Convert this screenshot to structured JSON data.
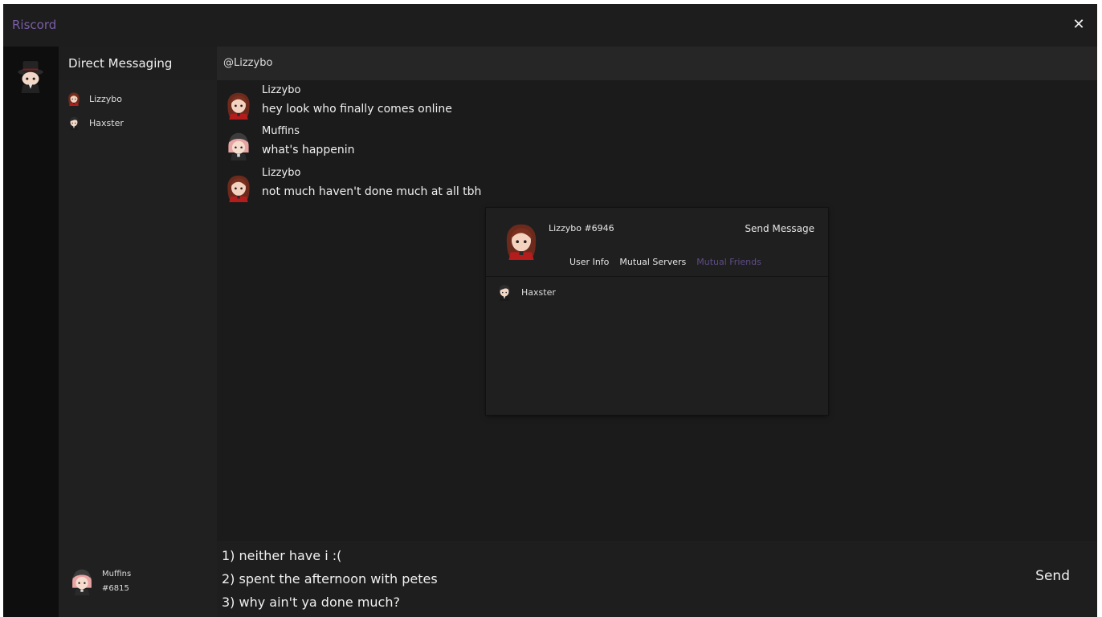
{
  "window": {
    "title": "Riscord",
    "close_icon": "✕"
  },
  "colors": {
    "accent": "#7b5ea7",
    "active_tab": "#5e4c84",
    "background": "#1c1c1c",
    "rail": "#0e0e0e"
  },
  "sidebar": {
    "header": "Direct Messaging",
    "items": [
      {
        "label": "Lizzybo",
        "avatar": "red-hair-girl-avatar"
      },
      {
        "label": "Haxster",
        "avatar": "dark-hair-boy-avatar"
      }
    ]
  },
  "self_user": {
    "name": "Muffins",
    "tag": "#6815",
    "avatar": "pink-hair-hat-avatar"
  },
  "chat": {
    "header": "@Lizzybo",
    "messages": [
      {
        "author": "Lizzybo",
        "text": "hey look who finally comes online",
        "avatar": "red-hair-girl-avatar"
      },
      {
        "author": "Muffins",
        "text": "what's happenin",
        "avatar": "pink-hair-hat-avatar"
      },
      {
        "author": "Lizzybo",
        "text": "not much haven't done much at all tbh",
        "avatar": "red-hair-girl-avatar"
      }
    ]
  },
  "profile_popup": {
    "name": "Lizzybo #6946",
    "send_label": "Send Message",
    "tabs": [
      {
        "label": "User Info",
        "active": false
      },
      {
        "label": "Mutual Servers",
        "active": false
      },
      {
        "label": "Mutual Friends",
        "active": true
      }
    ],
    "friends": [
      {
        "label": "Haxster"
      }
    ]
  },
  "composer": {
    "lines": [
      "1) neither have i :(",
      "2) spent the afternoon with petes",
      "3) why ain't ya done much?"
    ],
    "send_label": "Send"
  }
}
